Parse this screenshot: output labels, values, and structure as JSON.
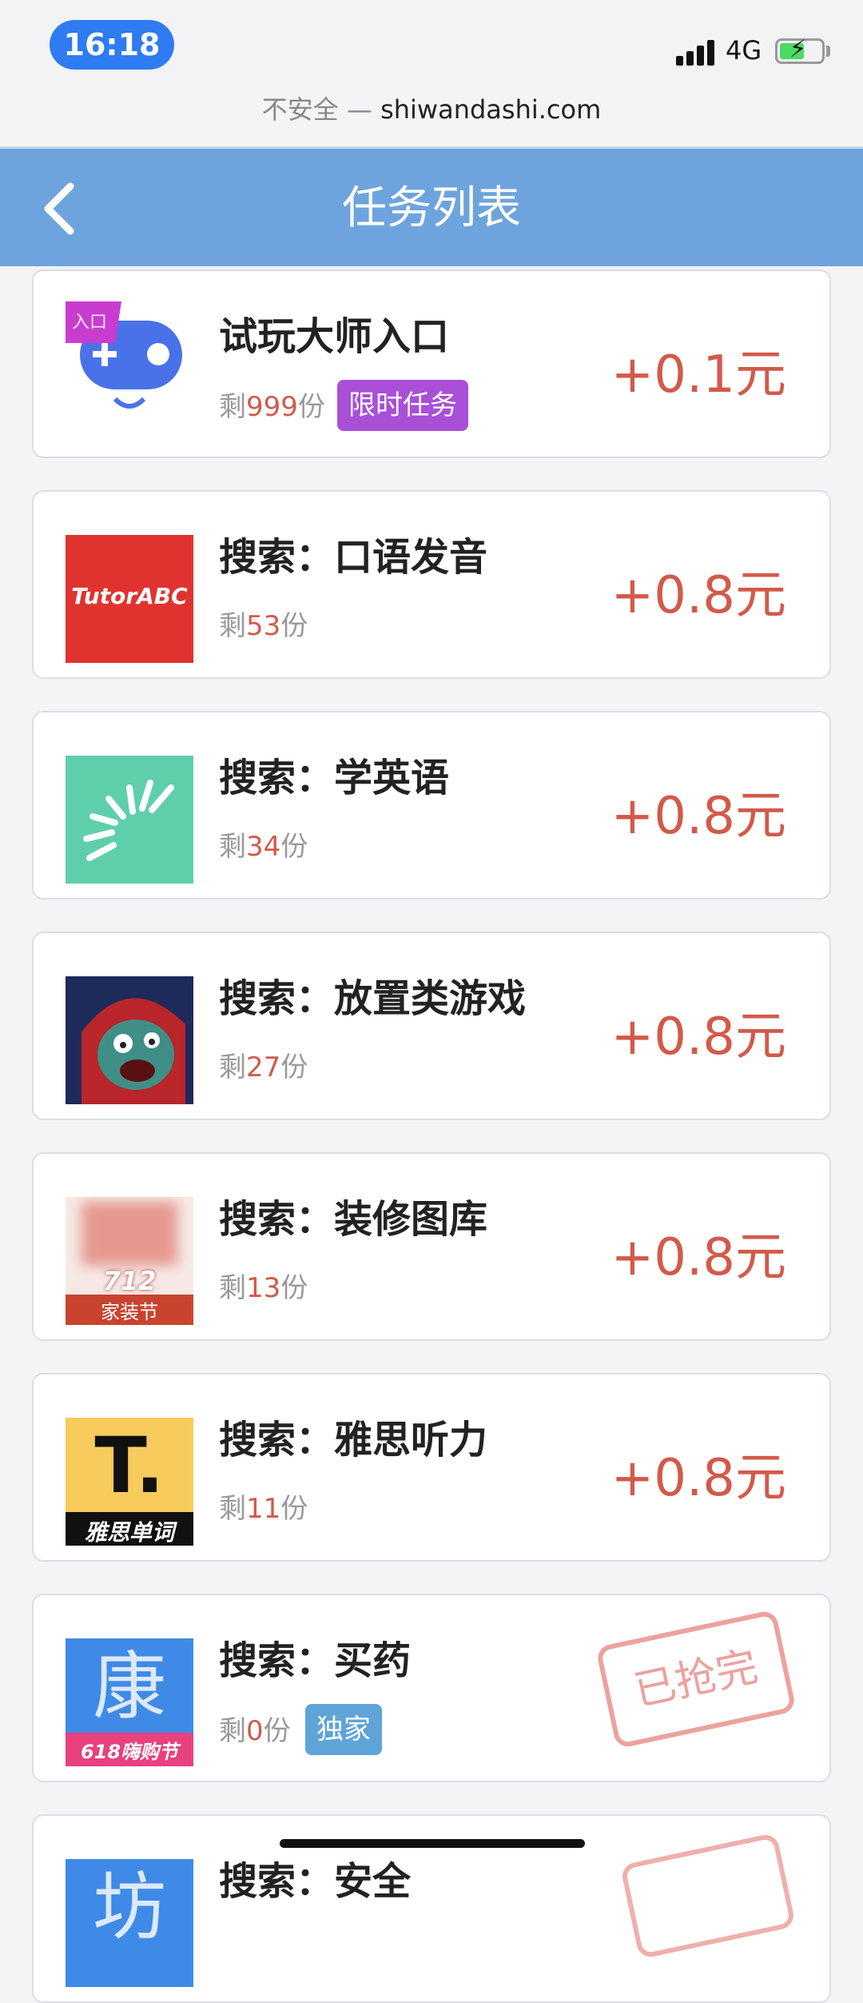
{
  "status_bar": {
    "time": "16:18",
    "network": "4G",
    "battery_charging": true
  },
  "browser": {
    "security": "不安全 —",
    "domain": "shiwandashi.com"
  },
  "header": {
    "title": "任务列表",
    "back_icon": "chevron-left-icon"
  },
  "colors": {
    "header_bg": "#6ea4dd",
    "accent_red": "#d25a4a",
    "tag_purple": "#a94fd8",
    "tag_blue": "#5fa4d8"
  },
  "tasks": [
    {
      "title": "试玩大师入口",
      "remain_prefix": "剩",
      "remain_count": "999",
      "remain_suffix": "份",
      "tag": "限时任务",
      "reward": "+0.1元",
      "icon": "gamepad-icon",
      "icon_badge": "入口"
    },
    {
      "title": "搜索：口语发音",
      "remain_prefix": "剩",
      "remain_count": "53",
      "remain_suffix": "份",
      "reward": "+0.8元",
      "icon": "tutorabc-app-icon",
      "icon_text": "TutorABC"
    },
    {
      "title": "搜索：学英语",
      "remain_prefix": "剩",
      "remain_count": "34",
      "remain_suffix": "份",
      "reward": "+0.8元",
      "icon": "learn-english-app-icon"
    },
    {
      "title": "搜索：放置类游戏",
      "remain_prefix": "剩",
      "remain_count": "27",
      "remain_suffix": "份",
      "reward": "+0.8元",
      "icon": "zombie-game-app-icon"
    },
    {
      "title": "搜索：装修图库",
      "remain_prefix": "剩",
      "remain_count": "13",
      "remain_suffix": "份",
      "reward": "+0.8元",
      "icon": "home-decor-app-icon",
      "icon_text": "712",
      "icon_subtext": "家装节"
    },
    {
      "title": "搜索：雅思听力",
      "remain_prefix": "剩",
      "remain_count": "11",
      "remain_suffix": "份",
      "reward": "+0.8元",
      "icon": "ielts-words-app-icon",
      "icon_text": "T.",
      "icon_subtext": "雅思单词"
    },
    {
      "title": "搜索：买药",
      "remain_prefix": "剩",
      "remain_count": "0",
      "remain_suffix": "份",
      "tag": "独家",
      "stamp": "已抢完",
      "icon": "pharmacy-app-icon",
      "icon_text": "康",
      "icon_subtext": "618嗨购节"
    },
    {
      "title": "搜索：安全",
      "icon": "safety-app-icon",
      "icon_text": "坊"
    }
  ]
}
